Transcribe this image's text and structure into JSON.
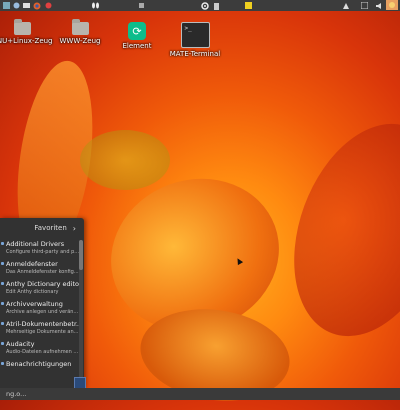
{
  "top_panel": {
    "icons": [
      "menu-icon",
      "network-icon",
      "file-manager-icon",
      "browser-icon",
      "settings-icon",
      "trash-icon",
      "note-icon",
      "tray-icon",
      "network-status-icon",
      "weather-icon"
    ]
  },
  "desktop": {
    "icons": [
      {
        "label": "GNU+Linux-Zeug",
        "icon": "folder-icon"
      },
      {
        "label": "WWW-Zeug",
        "icon": "folder-icon"
      },
      {
        "label": "Element",
        "icon": "element-app-icon"
      },
      {
        "label": "MATE-Terminal",
        "icon": "terminal-icon"
      }
    ]
  },
  "menu": {
    "favorites_label": "Favoriten",
    "items": [
      {
        "title": "Additional Drivers",
        "desc": "Configure third-party and p..."
      },
      {
        "title": "Anmeldefenster",
        "desc": "Das Anmeldefenster konfig..."
      },
      {
        "title": "Anthy Dictionary editor",
        "desc": "Edit Anthy dictionary"
      },
      {
        "title": "Archivverwaltung",
        "desc": "Archive anlegen und verän..."
      },
      {
        "title": "Atril-Dokumentenbetr...",
        "desc": "Mehrseitige Dokumente an..."
      },
      {
        "title": "Audacity",
        "desc": "Audio-Dateien aufnehmen ..."
      },
      {
        "title": "Benachrichtigungen",
        "desc": ""
      }
    ]
  },
  "bottom_panel": {
    "status_text": "ng.o..."
  },
  "colors": {
    "panel": "#3c3c3c",
    "menu_bg": "#323232",
    "element_green": "#0dbd8b"
  }
}
